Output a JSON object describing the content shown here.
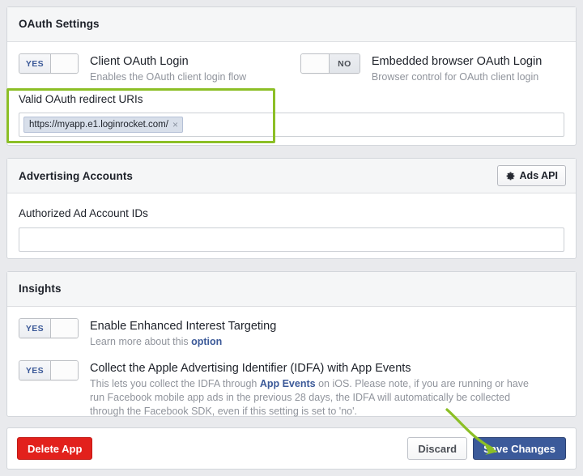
{
  "colors": {
    "page_background": "#e9eaed",
    "card_background": "#ffffff",
    "header_background": "#f5f6f7",
    "highlight_green": "#8cbf26",
    "link_blue": "#3b5998",
    "primary_button": "#3b5a9a",
    "danger_button": "#e2211c",
    "token_background": "#d8dfea"
  },
  "oauth_section": {
    "title": "OAuth Settings",
    "client_oauth": {
      "toggle_state": "YES",
      "toggle_on_label": "YES",
      "title": "Client OAuth Login",
      "subtitle": "Enables the OAuth client login flow"
    },
    "embedded_browser": {
      "toggle_state": "NO",
      "toggle_off_label": "NO",
      "title": "Embedded browser OAuth Login",
      "subtitle": "Browser control for OAuth client login"
    },
    "redirect_uris": {
      "label": "Valid OAuth redirect URIs",
      "tokens": [
        {
          "value": "https://myapp.e1.loginrocket.com/",
          "remove_icon": "×"
        }
      ],
      "placeholder": ""
    }
  },
  "advertising_section": {
    "title": "Advertising Accounts",
    "ads_api_button": {
      "label": "Ads API",
      "icon": "gear-icon"
    },
    "ad_account_ids": {
      "label": "Authorized Ad Account IDs",
      "value": "",
      "placeholder": ""
    }
  },
  "insights_section": {
    "title": "Insights",
    "rows": [
      {
        "toggle_state": "YES",
        "toggle_on_label": "YES",
        "title": "Enable Enhanced Interest Targeting",
        "description_prefix": "Learn more about this ",
        "description_link": "option",
        "description_suffix": ""
      },
      {
        "toggle_state": "YES",
        "toggle_on_label": "YES",
        "title": "Collect the Apple Advertising Identifier (IDFA) with App Events",
        "description_prefix": "This lets you collect the IDFA through ",
        "description_link": "App Events",
        "description_suffix": " on iOS. Please note, if you are running or have run Facebook mobile app ads in the previous 28 days, the IDFA will automatically be collected through the Facebook SDK, even if this setting is set to 'no'."
      }
    ]
  },
  "footer": {
    "delete_label": "Delete App",
    "discard_label": "Discard",
    "save_label": "Save Changes"
  },
  "annotation": {
    "arrow_color": "#8cbf26",
    "points_to": "save-changes-button"
  }
}
